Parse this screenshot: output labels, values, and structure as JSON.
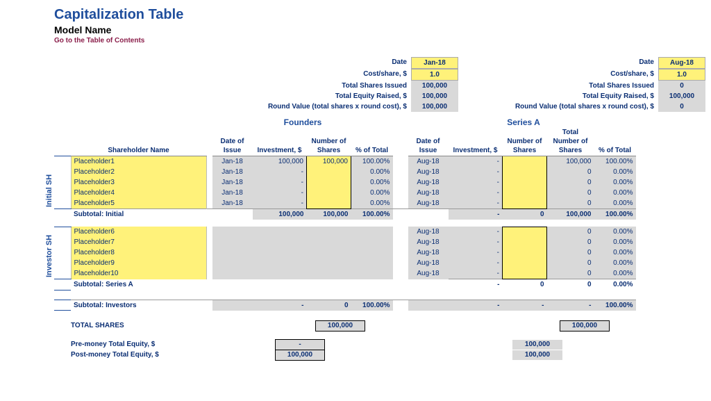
{
  "header": {
    "title": "Capitalization Table",
    "model": "Model Name",
    "toc": "Go to the Table of Contents"
  },
  "rounds": {
    "founders": {
      "title": "Founders",
      "date_lbl": "Date",
      "date": "Jan-18",
      "cost_lbl": "Cost/share, $",
      "cost": "1.0",
      "tsi_lbl": "Total Shares Issued",
      "tsi": "100,000",
      "ter_lbl": "Total Equity Raised, $",
      "ter": "100,000",
      "rv_lbl": "Round Value (total shares x round cost), $",
      "rv": "100,000"
    },
    "seriesA": {
      "title": "Series A",
      "date_lbl": "Date",
      "date": "Aug-18",
      "cost_lbl": "Cost/share, $",
      "cost": "1.0",
      "tsi_lbl": "Total Shares Issued",
      "tsi": "0",
      "ter_lbl": "Total Equity Raised, $",
      "ter": "100,000",
      "rv_lbl": "Round Value (total shares x round cost), $",
      "rv": "0"
    }
  },
  "cols": {
    "shareholder": "Shareholder Name",
    "date": "Date of Issue",
    "inv": "Investment, $",
    "shares": "Number of Shares",
    "pct": "% of Total",
    "totshares": "Total Number of Shares"
  },
  "side": {
    "initial": "Initial SH",
    "investor": "Investor SH"
  },
  "initial": [
    {
      "name": "Placeholder1",
      "f_date": "Jan-18",
      "f_inv": "100,000",
      "f_sh": "100,000",
      "f_pct": "100.00%",
      "a_date": "Aug-18",
      "a_inv": "-",
      "a_sh": "",
      "a_tot": "100,000",
      "a_pct": "100.00%"
    },
    {
      "name": "Placeholder2",
      "f_date": "Jan-18",
      "f_inv": "-",
      "f_sh": "",
      "f_pct": "0.00%",
      "a_date": "Aug-18",
      "a_inv": "-",
      "a_sh": "",
      "a_tot": "0",
      "a_pct": "0.00%"
    },
    {
      "name": "Placeholder3",
      "f_date": "Jan-18",
      "f_inv": "-",
      "f_sh": "",
      "f_pct": "0.00%",
      "a_date": "Aug-18",
      "a_inv": "-",
      "a_sh": "",
      "a_tot": "0",
      "a_pct": "0.00%"
    },
    {
      "name": "Placeholder4",
      "f_date": "Jan-18",
      "f_inv": "-",
      "f_sh": "",
      "f_pct": "0.00%",
      "a_date": "Aug-18",
      "a_inv": "-",
      "a_sh": "",
      "a_tot": "0",
      "a_pct": "0.00%"
    },
    {
      "name": "Placeholder5",
      "f_date": "Jan-18",
      "f_inv": "-",
      "f_sh": "",
      "f_pct": "0.00%",
      "a_date": "Aug-18",
      "a_inv": "-",
      "a_sh": "",
      "a_tot": "0",
      "a_pct": "0.00%"
    }
  ],
  "subtotal_initial": {
    "label": "Subtotal: Initial",
    "f_inv": "100,000",
    "f_sh": "100,000",
    "f_pct": "100.00%",
    "a_inv": "-",
    "a_sh": "0",
    "a_tot": "100,000",
    "a_pct": "100.00%"
  },
  "investors": [
    {
      "name": "Placeholder6",
      "a_date": "Aug-18",
      "a_inv": "-",
      "a_sh": "",
      "a_tot": "0",
      "a_pct": "0.00%"
    },
    {
      "name": "Placeholder7",
      "a_date": "Aug-18",
      "a_inv": "-",
      "a_sh": "",
      "a_tot": "0",
      "a_pct": "0.00%"
    },
    {
      "name": "Placeholder8",
      "a_date": "Aug-18",
      "a_inv": "-",
      "a_sh": "",
      "a_tot": "0",
      "a_pct": "0.00%"
    },
    {
      "name": "Placeholder9",
      "a_date": "Aug-18",
      "a_inv": "-",
      "a_sh": "",
      "a_tot": "0",
      "a_pct": "0.00%"
    },
    {
      "name": "Placeholder10",
      "a_date": "Aug-18",
      "a_inv": "-",
      "a_sh": "",
      "a_tot": "0",
      "a_pct": "0.00%"
    }
  ],
  "subtotal_seriesA": {
    "label": "Subtotal: Series A",
    "a_inv": "-",
    "a_sh": "0",
    "a_tot": "0",
    "a_pct": "0.00%"
  },
  "subtotal_investors": {
    "label": "Subtotal: Investors",
    "f_inv": "-",
    "f_sh": "0",
    "f_pct": "100.00%",
    "a_inv": "-",
    "a_sh": "-",
    "a_tot": "-",
    "a_pct": "100.00%"
  },
  "totals": {
    "total_shares_lbl": "TOTAL SHARES",
    "f_shares": "100,000",
    "a_shares": "100,000",
    "pre_lbl": "Pre-money Total Equity, $",
    "pre_f": "-",
    "pre_a": "100,000",
    "post_lbl": "Post-money Total Equity, $",
    "post_f": "100,000",
    "post_a": "100,000"
  }
}
